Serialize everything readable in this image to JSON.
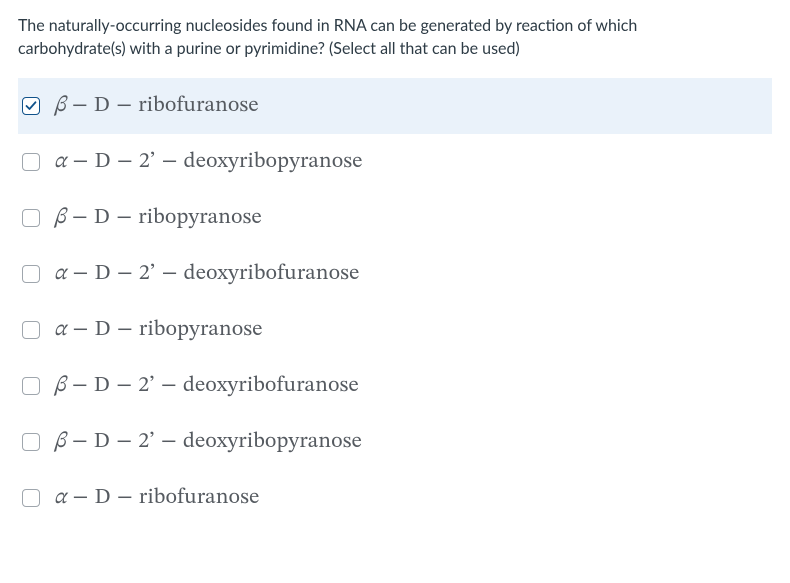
{
  "question": "The naturally-occurring nucleosides found in RNA can be generated by reaction of which carbohydrate(s) with a purine or pyrimidine?  (Select all that can be used)",
  "options": [
    {
      "prefix_greek": "β",
      "body": "D",
      "tail": "ribofuranose",
      "has_2prime": false,
      "checked": true
    },
    {
      "prefix_greek": "α",
      "body": "D",
      "tail": "deoxyribopyranose",
      "has_2prime": true,
      "checked": false
    },
    {
      "prefix_greek": "β",
      "body": "D",
      "tail": "ribopyranose",
      "has_2prime": false,
      "checked": false
    },
    {
      "prefix_greek": "α",
      "body": "D",
      "tail": "deoxyribofuranose",
      "has_2prime": true,
      "checked": false
    },
    {
      "prefix_greek": "α",
      "body": "D",
      "tail": "ribopyranose",
      "has_2prime": false,
      "checked": false
    },
    {
      "prefix_greek": "β",
      "body": "D",
      "tail": "deoxyribofuranose",
      "has_2prime": true,
      "checked": false
    },
    {
      "prefix_greek": "β",
      "body": "D",
      "tail": "deoxyribopyranose",
      "has_2prime": true,
      "checked": false
    },
    {
      "prefix_greek": "α",
      "body": "D",
      "tail": "ribofuranose",
      "has_2prime": false,
      "checked": false
    }
  ],
  "glyphs": {
    "minus": "−",
    "two_prime": "2’"
  }
}
